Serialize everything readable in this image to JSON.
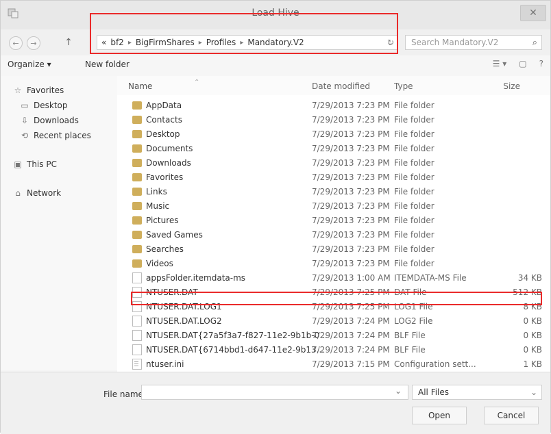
{
  "window": {
    "title": "Load Hive"
  },
  "address_bar": {
    "breadcrumbs": [
      "«",
      "bf2",
      "BigFirmShares",
      "Profiles",
      "Mandatory.V2"
    ],
    "separators": [
      "▸",
      "▸",
      "▸",
      "▸"
    ],
    "refresh_glyph": "↻",
    "dropdown_glyph": "⌄"
  },
  "search": {
    "placeholder": "Search Mandatory.V2",
    "icon": "search-icon"
  },
  "toolbar": {
    "organize_label": "Organize ▾",
    "new_folder_label": "New folder",
    "view_glyph": "☰ ▾",
    "preview_glyph": "▢",
    "help_glyph": "?"
  },
  "nav": {
    "favorites_label": "Favorites",
    "desktop_label": "Desktop",
    "downloads_label": "Downloads",
    "recent_label": "Recent places",
    "thispc_label": "This PC",
    "network_label": "Network"
  },
  "columns": {
    "name": "Name",
    "date": "Date modified",
    "type": "Type",
    "size": "Size"
  },
  "files": [
    {
      "name": "AppData",
      "date": "7/29/2013 7:23 PM",
      "type": "File folder",
      "size": ""
    },
    {
      "name": "Contacts",
      "date": "7/29/2013 7:23 PM",
      "type": "File folder",
      "size": ""
    },
    {
      "name": "Desktop",
      "date": "7/29/2013 7:23 PM",
      "type": "File folder",
      "size": ""
    },
    {
      "name": "Documents",
      "date": "7/29/2013 7:23 PM",
      "type": "File folder",
      "size": ""
    },
    {
      "name": "Downloads",
      "date": "7/29/2013 7:23 PM",
      "type": "File folder",
      "size": ""
    },
    {
      "name": "Favorites",
      "date": "7/29/2013 7:23 PM",
      "type": "File folder",
      "size": ""
    },
    {
      "name": "Links",
      "date": "7/29/2013 7:23 PM",
      "type": "File folder",
      "size": ""
    },
    {
      "name": "Music",
      "date": "7/29/2013 7:23 PM",
      "type": "File folder",
      "size": ""
    },
    {
      "name": "Pictures",
      "date": "7/29/2013 7:23 PM",
      "type": "File folder",
      "size": ""
    },
    {
      "name": "Saved Games",
      "date": "7/29/2013 7:23 PM",
      "type": "File folder",
      "size": ""
    },
    {
      "name": "Searches",
      "date": "7/29/2013 7:23 PM",
      "type": "File folder",
      "size": ""
    },
    {
      "name": "Videos",
      "date": "7/29/2013 7:23 PM",
      "type": "File folder",
      "size": ""
    },
    {
      "name": "appsFolder.itemdata-ms",
      "date": "7/29/2013 1:00 AM",
      "type": "ITEMDATA-MS File",
      "size": "34 KB"
    },
    {
      "name": "NTUSER.DAT",
      "date": "7/29/2013 7:25 PM",
      "type": "DAT File",
      "size": "512 KB"
    },
    {
      "name": "NTUSER.DAT.LOG1",
      "date": "7/29/2013 7:25 PM",
      "type": "LOG1 File",
      "size": "8 KB"
    },
    {
      "name": "NTUSER.DAT.LOG2",
      "date": "7/29/2013 7:24 PM",
      "type": "LOG2 File",
      "size": "0 KB"
    },
    {
      "name": "NTUSER.DAT{27a5f3a7-f827-11e2-9b1b-0...",
      "date": "7/29/2013 7:24 PM",
      "type": "BLF File",
      "size": "0 KB"
    },
    {
      "name": "NTUSER.DAT{6714bbd1-d647-11e2-9b13...",
      "date": "7/29/2013 7:24 PM",
      "type": "BLF File",
      "size": "0 KB"
    },
    {
      "name": "ntuser.ini",
      "date": "7/29/2013 7:15 PM",
      "type": "Configuration sett...",
      "size": "1 KB"
    }
  ],
  "bottom": {
    "filename_label": "File name:",
    "filetype_label": "All Files",
    "open_label": "Open",
    "cancel_label": "Cancel",
    "dropdown_glyph": "⌄"
  },
  "colors": {
    "accent_red": "#ea2a2a"
  }
}
